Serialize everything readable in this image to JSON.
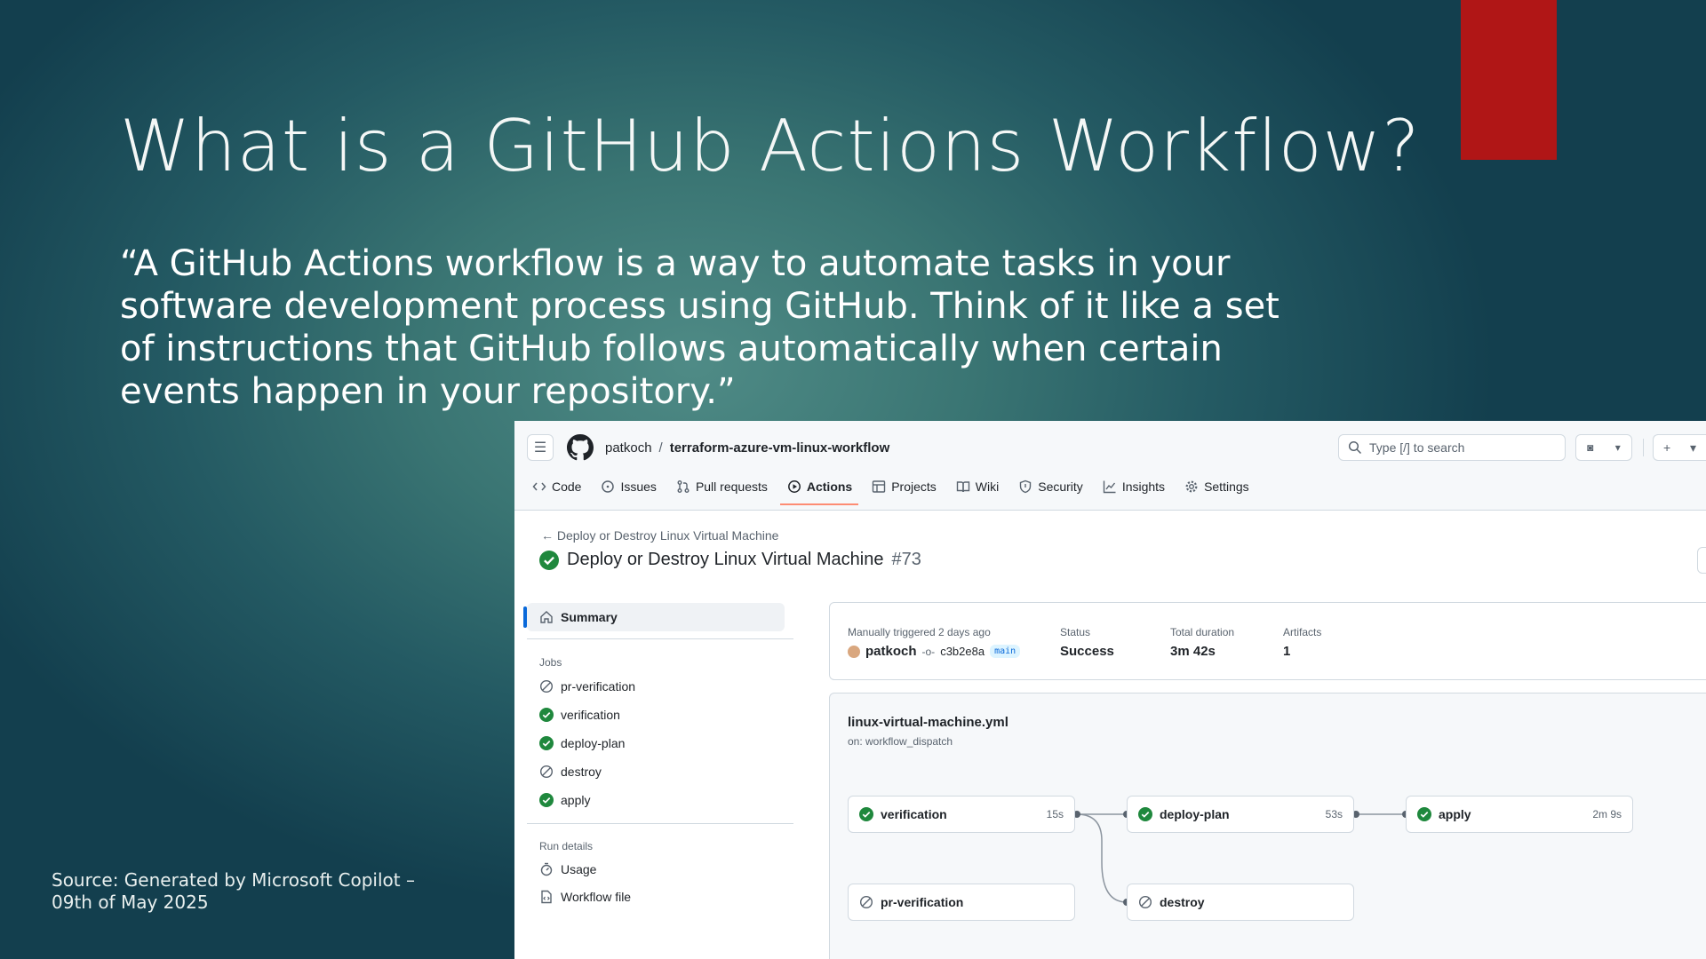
{
  "slide": {
    "title": "What is a GitHub Actions Workflow?",
    "quote": "“A GitHub Actions workflow is a way to automate tasks in your software development process using GitHub. Think of it like a set of instructions that GitHub follows automatically when certain events happen in your repository.”",
    "source": "Source: Generated by Microsoft Copilot – 09th of May 2025",
    "accent_color": "#b01616"
  },
  "github": {
    "owner": "patkoch",
    "separator": "/",
    "repo": "terraform-azure-vm-linux-workflow",
    "search_placeholder": "Type [/] to search",
    "tabs": [
      {
        "label": "Code",
        "icon": "code-icon"
      },
      {
        "label": "Issues",
        "icon": "issue-icon"
      },
      {
        "label": "Pull requests",
        "icon": "pull-request-icon"
      },
      {
        "label": "Actions",
        "icon": "play-icon",
        "active": true
      },
      {
        "label": "Projects",
        "icon": "table-icon"
      },
      {
        "label": "Wiki",
        "icon": "book-icon"
      },
      {
        "label": "Security",
        "icon": "shield-icon"
      },
      {
        "label": "Insights",
        "icon": "graph-icon"
      },
      {
        "label": "Settings",
        "icon": "gear-icon"
      }
    ],
    "run": {
      "back_label": "Deploy or Destroy Linux Virtual Machine",
      "title": "Deploy or Destroy Linux Virtual Machine",
      "number": "#73"
    },
    "sidebar": {
      "summary": "Summary",
      "jobs_heading": "Jobs",
      "jobs": [
        {
          "label": "pr-verification",
          "status": "skipped"
        },
        {
          "label": "verification",
          "status": "success"
        },
        {
          "label": "deploy-plan",
          "status": "success"
        },
        {
          "label": "destroy",
          "status": "skipped"
        },
        {
          "label": "apply",
          "status": "success"
        }
      ],
      "run_details_heading": "Run details",
      "usage": "Usage",
      "workflow_file": "Workflow file"
    },
    "summary": {
      "trigger_label": "Manually triggered 2 days ago",
      "actor": "patkoch",
      "commit": "c3b2e8a",
      "branch": "main",
      "status_label": "Status",
      "status_value": "Success",
      "duration_label": "Total duration",
      "duration_value": "3m 42s",
      "artifacts_label": "Artifacts",
      "artifacts_value": "1"
    },
    "graph": {
      "file": "linux-virtual-machine.yml",
      "on": "on: workflow_dispatch",
      "nodes": {
        "verification": {
          "label": "verification",
          "duration": "15s",
          "status": "success"
        },
        "deploy_plan": {
          "label": "deploy-plan",
          "duration": "53s",
          "status": "success"
        },
        "apply": {
          "label": "apply",
          "duration": "2m 9s",
          "status": "success"
        },
        "pr_verification": {
          "label": "pr-verification",
          "duration": "",
          "status": "skipped"
        },
        "destroy": {
          "label": "destroy",
          "duration": "",
          "status": "skipped"
        }
      }
    },
    "colors": {
      "success": "#1f883d",
      "skipped": "#59636e",
      "active_tab": "#fd8c73",
      "selected_bar": "#0969da"
    }
  }
}
